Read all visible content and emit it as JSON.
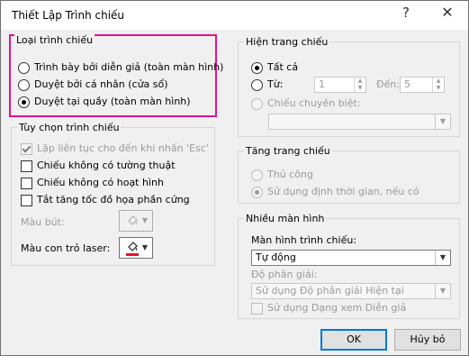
{
  "window": {
    "title": "Thiết Lập Trình chiếu",
    "help_label": "?",
    "close_label": "✕"
  },
  "show_type": {
    "label": "Loại trình chiếu",
    "options": [
      {
        "label": "Trình bày bởi diễn giả (toàn màn hình)",
        "selected": false
      },
      {
        "label": "Duyệt bởi cá nhân (cửa sổ)",
        "selected": false
      },
      {
        "label": "Duyệt tại quầy (toàn màn hình)",
        "selected": true
      }
    ],
    "highlight_color": "#e0148c"
  },
  "show_options": {
    "label": "Tùy chọn trình chiếu",
    "checkboxes": [
      {
        "label": "Lặp liên tục cho đến khi nhấn 'Esc'",
        "checked": true,
        "disabled": true
      },
      {
        "label": "Chiếu không có tường thuật",
        "checked": false,
        "disabled": false
      },
      {
        "label": "Chiếu không có hoạt hình",
        "checked": false,
        "disabled": false
      },
      {
        "label": "Tắt tăng tốc đồ họa phần cứng",
        "checked": false,
        "disabled": false
      }
    ],
    "pen_color_label": "Màu bút:",
    "laser_color_label": "Màu con trỏ laser:",
    "laser_color": "#e81123"
  },
  "show_slides": {
    "label": "Hiện trang chiếu",
    "all_label": "Tất cả",
    "from_label": "Từ:",
    "from_value": "1",
    "to_label": "Đến:",
    "to_value": "5",
    "custom_label": "Chiếu chuyên biệt:",
    "custom_value": ""
  },
  "advance": {
    "label": "Tăng trang chiếu",
    "manual_label": "Thủ công",
    "timings_label": "Sử dụng định thời gian, nếu có"
  },
  "multiple_monitors": {
    "label": "Nhiều màn hình",
    "monitor_label": "Màn hình trình chiếu:",
    "monitor_value": "Tự động",
    "resolution_label": "Độ phân giải:",
    "resolution_value": "Sử dụng Độ phân giải Hiện tại",
    "presenter_view_label": "Sử dụng Dạng xem Diễn giả"
  },
  "buttons": {
    "ok_label": "OK",
    "cancel_label": "Hủy bỏ"
  }
}
